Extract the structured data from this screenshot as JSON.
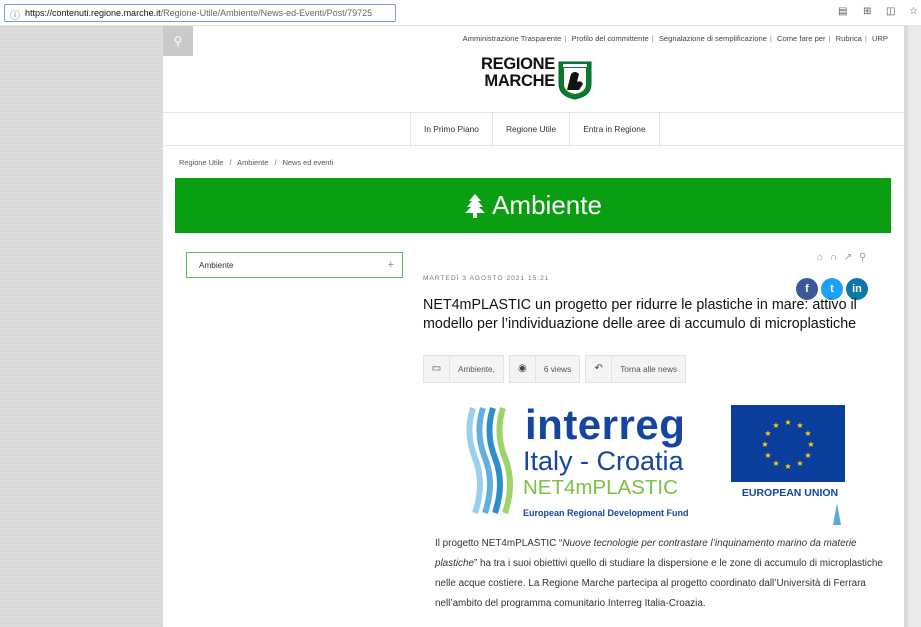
{
  "browser": {
    "url_domain": "https://contenuti.regione.marche.it",
    "url_path": "/Regione-Utile/Ambiente/News-ed-Eventi/Post/79725",
    "icons": [
      "page-info-icon",
      "reader-icon",
      "grid-icon",
      "split-icon",
      "favorite-icon"
    ]
  },
  "header": {
    "top_links": [
      "Amministrazione Trasparente",
      "Profilo del committente",
      "Segnalazione di semplificazione",
      "Come fare per",
      "Rubrica",
      "URP"
    ],
    "logo_line1": "REGIONE",
    "logo_line2": "MARCHE"
  },
  "nav": {
    "items": [
      "In Primo Piano",
      "Regione Utile",
      "Entra in Regione"
    ]
  },
  "breadcrumb": {
    "items": [
      "Regione Utile",
      "Ambiente",
      "News ed eventi"
    ],
    "separator": "/"
  },
  "banner": {
    "icon": "tree-icon",
    "title": "Ambiente"
  },
  "sidebar": {
    "label": "Ambiente",
    "expand": "+"
  },
  "article": {
    "date": "MARTEDÌ 3 AGOSTO 2021 15:21",
    "title": "NET4mPLASTIC un progetto per ridurre le plastiche in mare: attivo il modello per l’individuazione delle aree di accumulo di microplastiche",
    "category": "Ambiente,",
    "views": "6 views",
    "back": "Torna alle news",
    "social": [
      "f",
      "t",
      "in"
    ],
    "body_intro": "Il progetto NET4mPLASTIC “",
    "body_quote": "Nuove tecnologie per contrastare l’inquinamento marino da materie plastiche",
    "body_rest": "” ha tra i suoi obiettivi quello di studiare la dispersione e le zone di accumulo di microplastiche nelle acque costiere. La Regione Marche partecipa al progetto coordinato dall’Università di Ferrara nell’ambito del programma comunitario Interreg Italia-Croazia."
  },
  "program_logo": {
    "interreg": "interreg",
    "italy_croatia": "Italy - Croatia",
    "net4": "NET4mPLASTIC",
    "fund": "European Regional Development Fund",
    "eu": "EUROPEAN UNION"
  },
  "colors": {
    "banner_green": "#0a9e12",
    "interreg_blue": "#1446a0",
    "net4_green": "#7bc142",
    "eu_blue": "#0a3d9c"
  }
}
